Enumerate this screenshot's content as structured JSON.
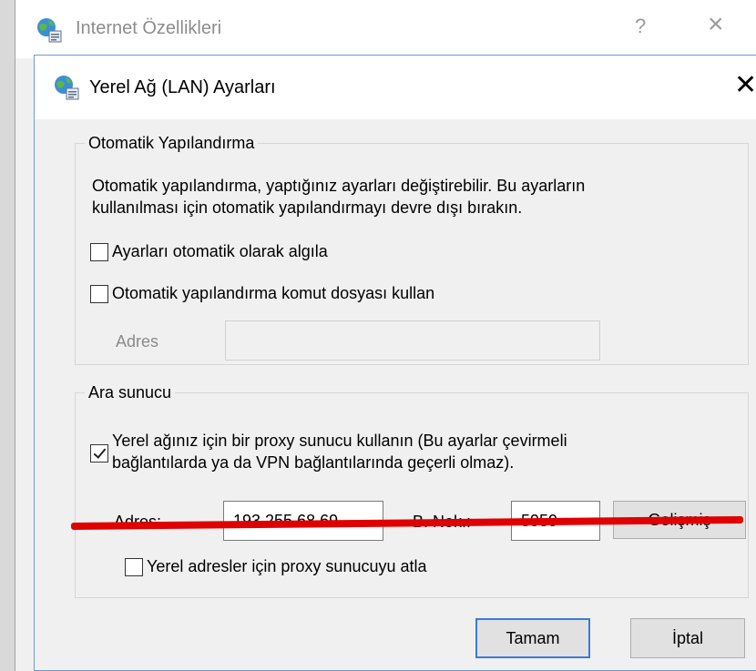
{
  "outer_window": {
    "title": "Internet Özellikleri",
    "help_label": "?",
    "close_label": "×"
  },
  "dialog": {
    "title": "Yerel Ağ (LAN) Ayarları",
    "close_label": "✕"
  },
  "auto_config": {
    "legend": "Otomatik Yapılandırma",
    "description_line1": "Otomatik yapılandırma, yaptığınız ayarları değiştirebilir. Bu ayarların",
    "description_line2": "kullanılması için otomatik yapılandırmayı devre dışı bırakın.",
    "detect_label": "Ayarları otomatik olarak algıla",
    "detect_checked": false,
    "script_label": "Otomatik yapılandırma komut dosyası kullan",
    "script_checked": false,
    "address_label": "Adres",
    "address_value": ""
  },
  "proxy": {
    "legend": "Ara sunucu",
    "use_proxy_line1": "Yerel ağınız için bir proxy sunucu kullanın (Bu ayarlar çevirmeli",
    "use_proxy_line2": "bağlantılarda ya da VPN bağlantılarında geçerli olmaz).",
    "use_proxy_checked": true,
    "address_label": "Adres:",
    "address_value": "193.255.68.69",
    "port_label": "B. Nok.:",
    "port_value": "5959",
    "advanced_label": "Gelişmiş",
    "bypass_label": "Yerel adresler için proxy sunucuyu atla",
    "bypass_checked": false
  },
  "buttons": {
    "ok_label": "Tamam",
    "cancel_label": "İptal"
  },
  "colors": {
    "annotation_line": "#e00000",
    "default_button_border": "#3a7bd5"
  },
  "icons": {
    "window_icon": "globe-network-icon"
  }
}
